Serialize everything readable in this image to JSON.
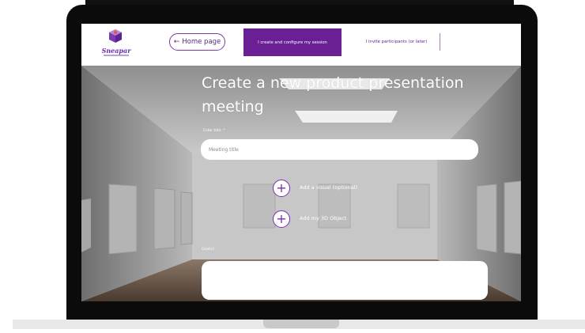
{
  "app": {
    "logo_text": "Sneapar"
  },
  "header": {
    "home_button": "Home page",
    "tab_active": "I create and configure my session",
    "tab_inactive": "I invite participants (or later)"
  },
  "form": {
    "page_title": "Create a new product presentation meeting",
    "title_label": "Enter title: *",
    "title_placeholder": "Meeting title",
    "add_visual": "Add a visual (optional)",
    "add_3d": "Add my 3D Object",
    "goals_label": "Goal(s)"
  },
  "colors": {
    "accent": "#6a1f94",
    "accent_border": "#7b3aa6"
  }
}
